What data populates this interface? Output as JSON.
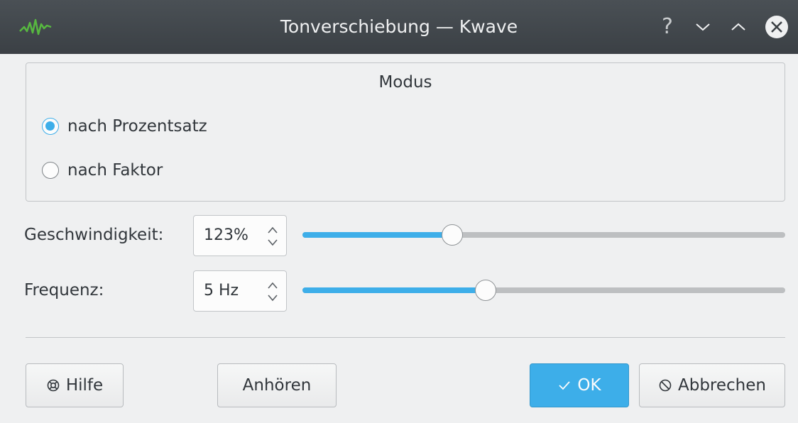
{
  "window": {
    "title": "Tonverschiebung — Kwave",
    "help_glyph": "?",
    "app_icon": "kwave-waveform-icon",
    "accent": "#3daee9"
  },
  "mode_group": {
    "title": "Modus",
    "options": [
      {
        "label": "nach Prozentsatz",
        "checked": true
      },
      {
        "label": "nach Faktor",
        "checked": false
      }
    ]
  },
  "speed": {
    "label": "Geschwindigkeit:",
    "value": "123%",
    "slider_fraction": 0.31
  },
  "frequency": {
    "label": "Frequenz:",
    "value": "5 Hz",
    "slider_fraction": 0.38
  },
  "buttons": {
    "help": "Hilfe",
    "listen": "Anhören",
    "ok": "OK",
    "cancel": "Abbrechen"
  }
}
